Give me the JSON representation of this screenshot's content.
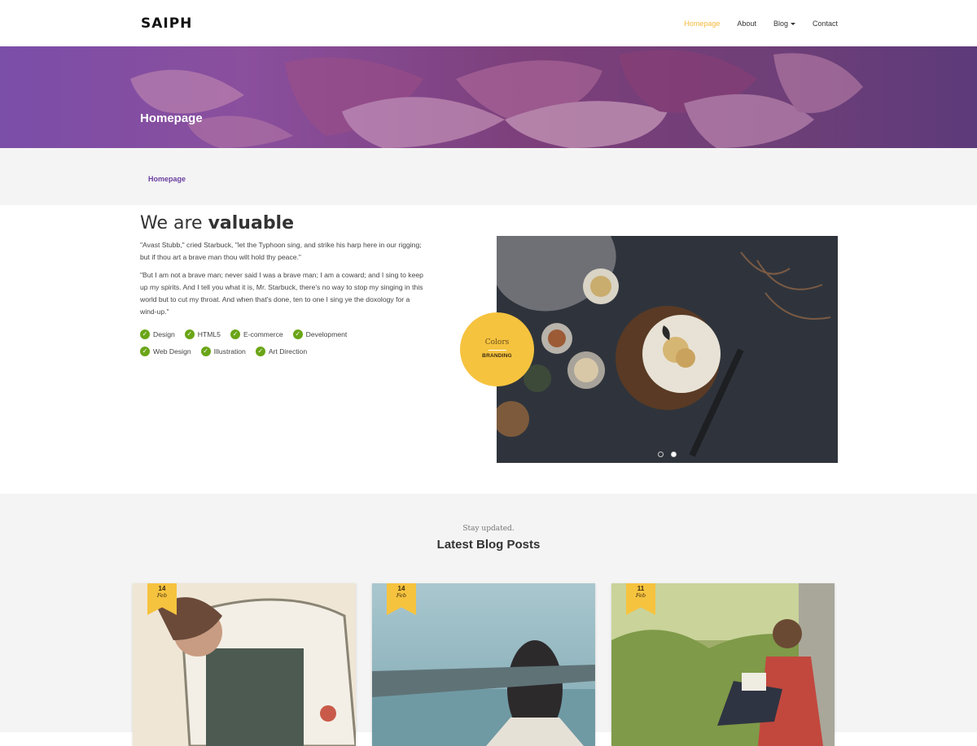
{
  "brand": {
    "logo": "SAIPH"
  },
  "nav": {
    "items": [
      {
        "label": "Homepage"
      },
      {
        "label": "About"
      },
      {
        "label": "Blog"
      },
      {
        "label": "Contact"
      }
    ]
  },
  "hero": {
    "title": "Homepage"
  },
  "breadcrumb": {
    "current": "Homepage"
  },
  "about": {
    "title_light": "We are",
    "title_bold": "valuable",
    "paragraph1": "\"Avast Stubb,\" cried Starbuck, \"let the Typhoon sing, and strike his harp here in our rigging; but if thou art a brave man thou wilt hold thy peace.\"",
    "paragraph2": "\"But I am not a brave man; never said I was a brave man; I am a coward; and I sing to keep up my spirits. And I tell you what it is, Mr. Starbuck, there's no way to stop my singing in this world but to cut my throat. And when that's done, ten to one I sing ye the doxology for a wind-up.\"",
    "features_row1": [
      "Design",
      "HTML5",
      "E-commerce",
      "Development"
    ],
    "features_row2": [
      "Web Design",
      "Illustration",
      "Art Direction"
    ]
  },
  "slider": {
    "badge_title": "Colors",
    "badge_subtitle": "BRANDING",
    "slide_count": 2,
    "active_slide": 2
  },
  "blog": {
    "kicker": "Stay updated.",
    "title": "Latest Blog Posts",
    "posts": [
      {
        "day": "14",
        "month": "Feb"
      },
      {
        "day": "14",
        "month": "Feb"
      },
      {
        "day": "11",
        "month": "Feb"
      }
    ]
  },
  "colors": {
    "accent": "#f6b93b",
    "purple": "#6b3fa0",
    "badge": "#f6c33f",
    "check_green": "#6aa517",
    "section_bg": "#f4f4f4"
  }
}
